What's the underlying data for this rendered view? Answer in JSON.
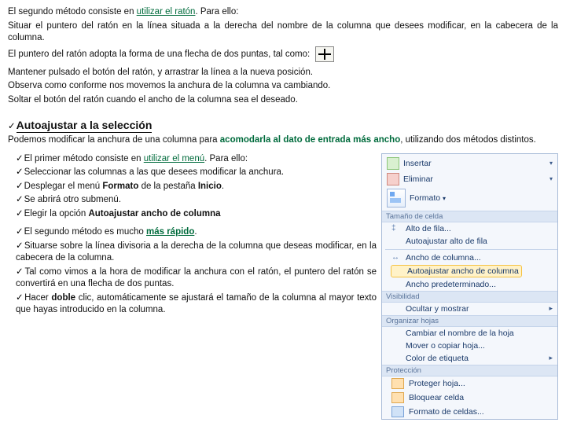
{
  "intro": {
    "line1a": "El segundo método consiste en ",
    "line1b": "utilizar el ratón",
    "line1c": ". Para ello:",
    "line2": "Situar el puntero del ratón en la línea situada a la derecha del nombre de la columna que desees modificar, en la cabecera de la columna.",
    "line3": "El puntero del ratón adopta la forma de una flecha de dos puntas, tal como:"
  },
  "keep": {
    "l1": "Mantener pulsado el botón del ratón, y arrastrar la línea a la nueva posición.",
    "l2": "Observa como conforme nos movemos la anchura de la columna va cambiando.",
    "l3": "Soltar el botón del ratón cuando el ancho de la columna sea el deseado."
  },
  "heading": "Autoajustar a la selección",
  "para2a": "Podemos modificar la anchura de una columna para ",
  "para2b": "acomodarla al dato de entrada más ancho",
  "para2c": ", utilizando dos métodos distintos.",
  "method1": {
    "a1": "El primer método consiste en ",
    "a1b": "utilizar el menú",
    "a1c": ". Para ello:",
    "a2": "Seleccionar las columnas a las que desees modificar la anchura.",
    "a3a": "Desplegar el menú ",
    "a3b": "Formato",
    "a3c": " de la pestaña ",
    "a3d": "Inicio",
    "a3e": ".",
    "a4": "Se abrirá otro submenú.",
    "a5a": "Elegir la opción ",
    "a5b": "Autoajustar ancho de columna"
  },
  "method2": {
    "b1a": "El segundo método es mucho ",
    "b1b": "más rápido",
    "b1c": ".",
    "b2": "Situarse sobre la línea divisoria a la derecha de la columna que deseas modificar, en la cabecera de la columna.",
    "b3": "Tal como vimos a la hora de modificar la anchura con el ratón, el puntero del ratón se convertirá en una flecha de dos puntas.",
    "b4a": "Hacer ",
    "b4b": "doble",
    "b4c": " clic, automáticamente se ajustará el tamaño de la columna al mayor texto que hayas introducido en la columna."
  },
  "menu": {
    "insertar": "Insertar",
    "eliminar": "Eliminar",
    "formato": "Formato",
    "sec_tam": "Tamaño de celda",
    "alto_fila": "Alto de fila...",
    "auto_fila": "Autoajustar alto de fila",
    "ancho_col": "Ancho de columna...",
    "auto_col": "Autoajustar ancho de columna",
    "ancho_pred": "Ancho predeterminado...",
    "sec_vis": "Visibilidad",
    "ocultar": "Ocultar y mostrar",
    "sec_org": "Organizar hojas",
    "renombrar": "Cambiar el nombre de la hoja",
    "mover": "Mover o copiar hoja...",
    "color_tab": "Color de etiqueta",
    "sec_prot": "Protección",
    "prot_hoja": "Proteger hoja...",
    "bloq_celda": "Bloquear celda",
    "fmt_celdas": "Formato de celdas..."
  }
}
